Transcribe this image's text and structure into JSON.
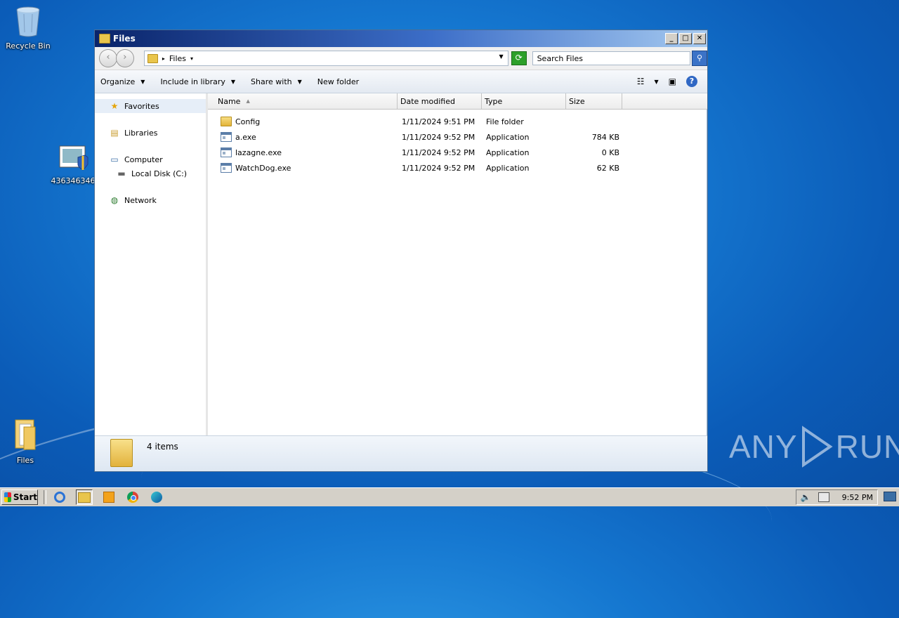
{
  "desktop": {
    "icons": [
      {
        "label": "Recycle Bin",
        "icon": "recycle-bin-icon"
      },
      {
        "label": "436346346",
        "icon": "app-shield-icon"
      },
      {
        "label": "Files",
        "icon": "folder-icon"
      }
    ],
    "watermark": {
      "left": "ANY",
      "right": "RUN"
    }
  },
  "window": {
    "title": "Files",
    "controls": {
      "minimize": "_",
      "maximize": "□",
      "close": "✕"
    },
    "address": {
      "crumb": "Files"
    },
    "search": {
      "placeholder": "Search Files"
    },
    "toolbar": {
      "organize": "Organize",
      "include_in_library": "Include in library",
      "share_with": "Share with",
      "new_folder": "New folder"
    },
    "nav": {
      "favorites": "Favorites",
      "libraries": "Libraries",
      "computer": "Computer",
      "local_disk": "Local Disk (C:)",
      "network": "Network"
    },
    "columns": {
      "name": "Name",
      "date": "Date modified",
      "type": "Type",
      "size": "Size"
    },
    "files": [
      {
        "name": "Config",
        "date": "1/11/2024 9:51 PM",
        "type": "File folder",
        "size": "",
        "icon": "folder-icon"
      },
      {
        "name": "a.exe",
        "date": "1/11/2024 9:52 PM",
        "type": "Application",
        "size": "784 KB",
        "icon": "exe-icon"
      },
      {
        "name": "lazagne.exe",
        "date": "1/11/2024 9:52 PM",
        "type": "Application",
        "size": "0 KB",
        "icon": "exe-icon"
      },
      {
        "name": "WatchDog.exe",
        "date": "1/11/2024 9:52 PM",
        "type": "Application",
        "size": "62 KB",
        "icon": "exe-icon"
      }
    ],
    "status": {
      "count": "4 items"
    }
  },
  "taskbar": {
    "start_label": "Start",
    "clock": "9:52 PM"
  }
}
